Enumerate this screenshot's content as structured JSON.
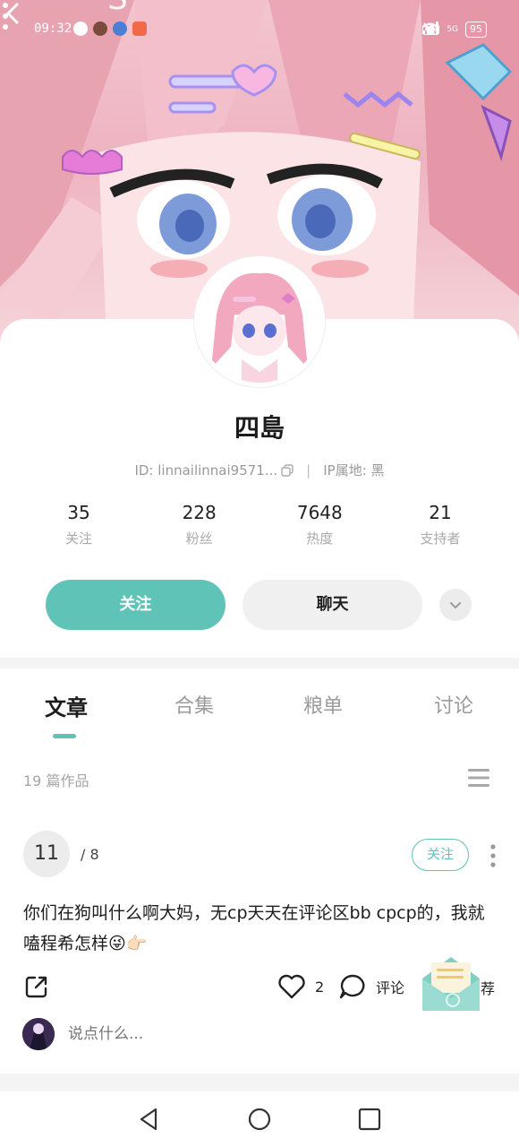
{
  "status_bar": {
    "time": "09:32",
    "network": "5G",
    "hd": "HD",
    "battery": "95"
  },
  "profile": {
    "username": "四島",
    "id_text": "ID: linnailinnai9571...",
    "ip_text": "IP属地:",
    "ip_value": "黑",
    "separator": "|"
  },
  "stats": [
    {
      "value": "35",
      "label": "关注"
    },
    {
      "value": "228",
      "label": "粉丝"
    },
    {
      "value": "7648",
      "label": "热度"
    },
    {
      "value": "21",
      "label": "支持者"
    }
  ],
  "actions": {
    "follow": "关注",
    "chat": "聊天"
  },
  "tabs": [
    {
      "label": "文章",
      "active": true
    },
    {
      "label": "合集",
      "active": false
    },
    {
      "label": "粮单",
      "active": false
    },
    {
      "label": "讨论",
      "active": false
    }
  ],
  "works_count": "19 篇作品",
  "post": {
    "avatar_text": "11",
    "author": "/ 8",
    "follow_label": "关注",
    "text": "你们在狗叫什么啊大妈，无cp天天在评论区bb cpcp的，我就嗑程希怎样😜👉🏻",
    "like_count": "2",
    "comment_label": "评论",
    "recommend_label": "荐",
    "reply_placeholder": "说点什么..."
  },
  "colors": {
    "accent": "#5fc3b8",
    "banner": "#f0b9c5"
  }
}
